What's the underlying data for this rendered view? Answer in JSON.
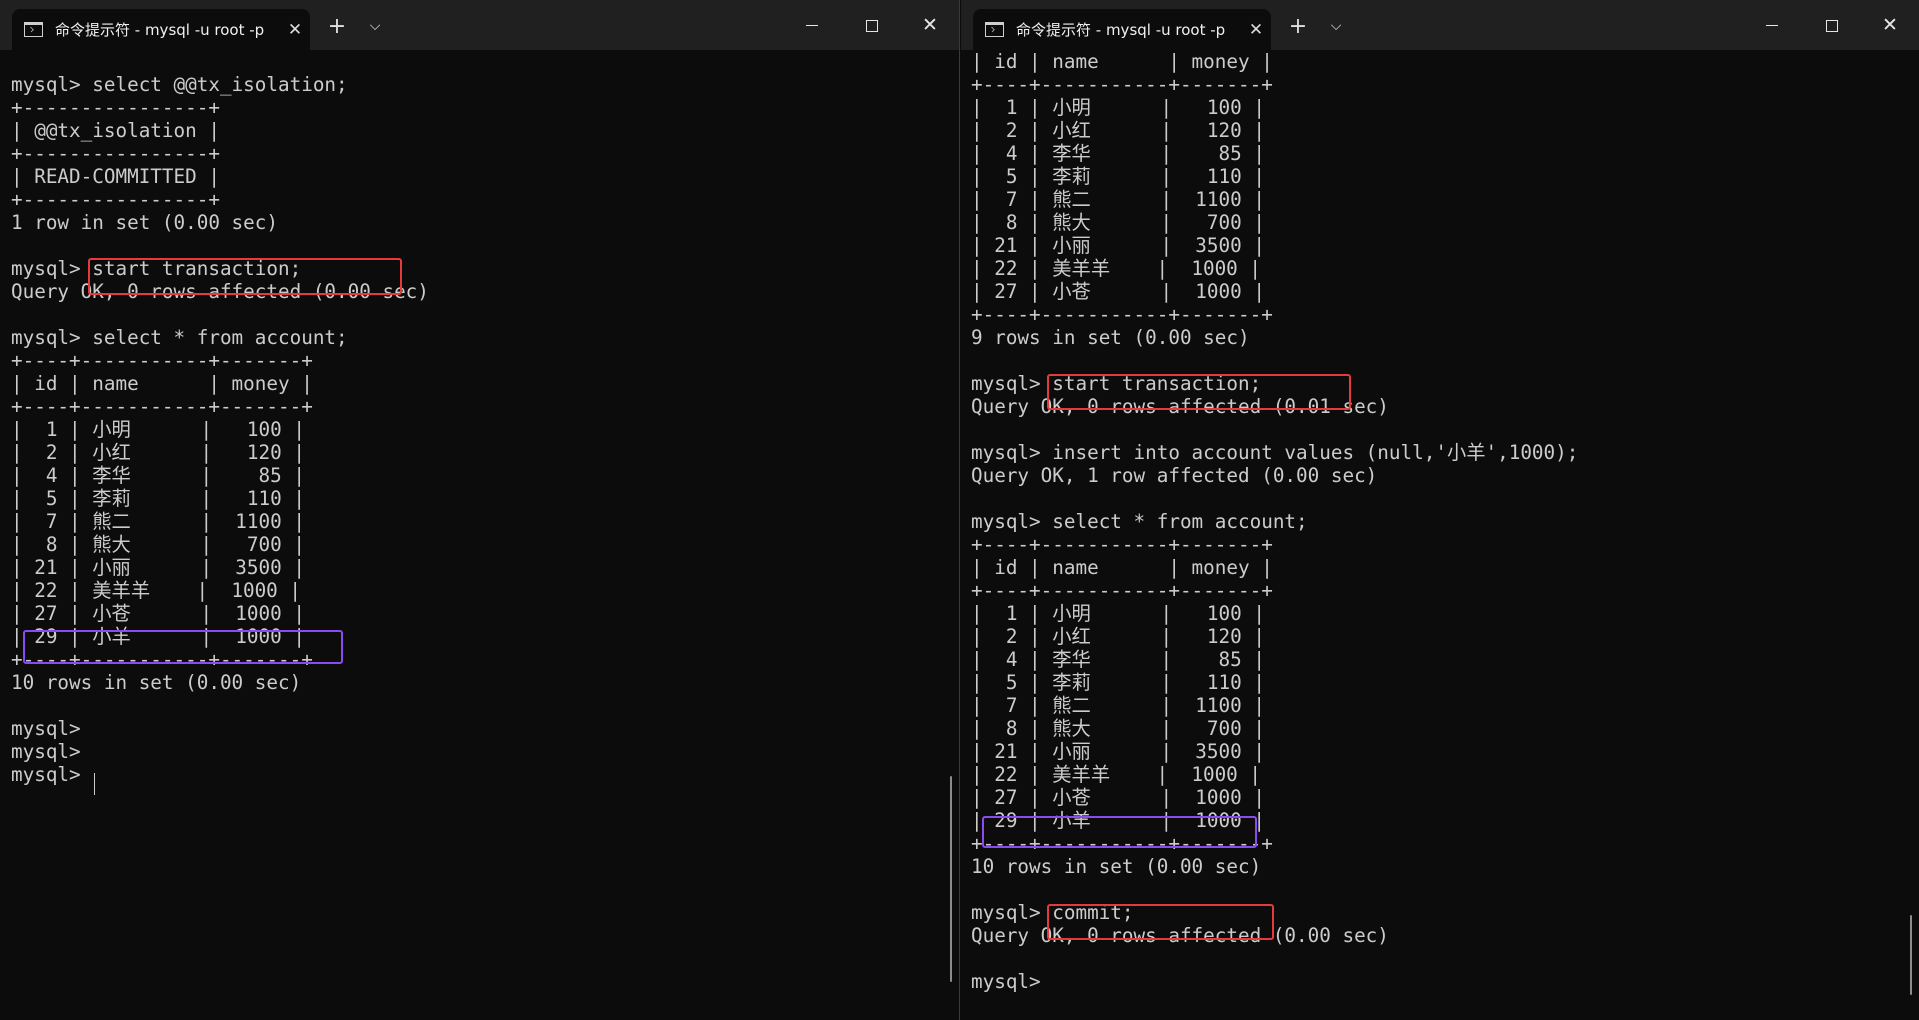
{
  "windows": [
    {
      "tab_title": "命令提示符 - mysql  -u root -p",
      "console": "mysql> select @@tx_isolation;\n+----------------+\n| @@tx_isolation |\n+----------------+\n| READ-COMMITTED |\n+----------------+\n1 row in set (0.00 sec)\n\nmysql> start transaction;\nQuery OK, 0 rows affected (0.00 sec)\n\nmysql> select * from account;\n+----+-----------+-------+\n| id | name      | money |\n+----+-----------+-------+\n|  1 | 小明      |   100 |\n|  2 | 小红      |   120 |\n|  4 | 李华      |    85 |\n|  5 | 李莉      |   110 |\n|  7 | 熊二      |  1100 |\n|  8 | 熊大      |   700 |\n| 21 | 小丽      |  3500 |\n| 22 | 美羊羊    |  1000 |\n| 27 | 小苍      |  1000 |\n| 29 | 小羊      |  1000 |\n+----+-----------+-------+\n10 rows in set (0.00 sec)\n\nmysql>\nmysql>\nmysql> "
    },
    {
      "tab_title": "命令提示符 - mysql  -u root -p",
      "console": "| id | name      | money |\n+----+-----------+-------+\n|  1 | 小明      |   100 |\n|  2 | 小红      |   120 |\n|  4 | 李华      |    85 |\n|  5 | 李莉      |   110 |\n|  7 | 熊二      |  1100 |\n|  8 | 熊大      |   700 |\n| 21 | 小丽      |  3500 |\n| 22 | 美羊羊    |  1000 |\n| 27 | 小苍      |  1000 |\n+----+-----------+-------+\n9 rows in set (0.00 sec)\n\nmysql> start transaction;\nQuery OK, 0 rows affected (0.01 sec)\n\nmysql> insert into account values (null,'小羊',1000);\nQuery OK, 1 row affected (0.00 sec)\n\nmysql> select * from account;\n+----+-----------+-------+\n| id | name      | money |\n+----+-----------+-------+\n|  1 | 小明      |   100 |\n|  2 | 小红      |   120 |\n|  4 | 李华      |    85 |\n|  5 | 李莉      |   110 |\n|  7 | 熊二      |  1100 |\n|  8 | 熊大      |   700 |\n| 21 | 小丽      |  3500 |\n| 22 | 美羊羊    |  1000 |\n| 27 | 小苍      |  1000 |\n| 29 | 小羊      |  1000 |\n+----+-----------+-------+\n10 rows in set (0.00 sec)\n\nmysql> commit;\nQuery OK, 0 rows affected (0.00 sec)\n\nmysql> "
    }
  ],
  "controls": {
    "new_tab": "+",
    "dropdown": "⌵",
    "tab_close": "✕",
    "window_close": "✕"
  },
  "colors": {
    "highlight_red": "#e53b3b",
    "highlight_purple": "#8a4cf0"
  }
}
